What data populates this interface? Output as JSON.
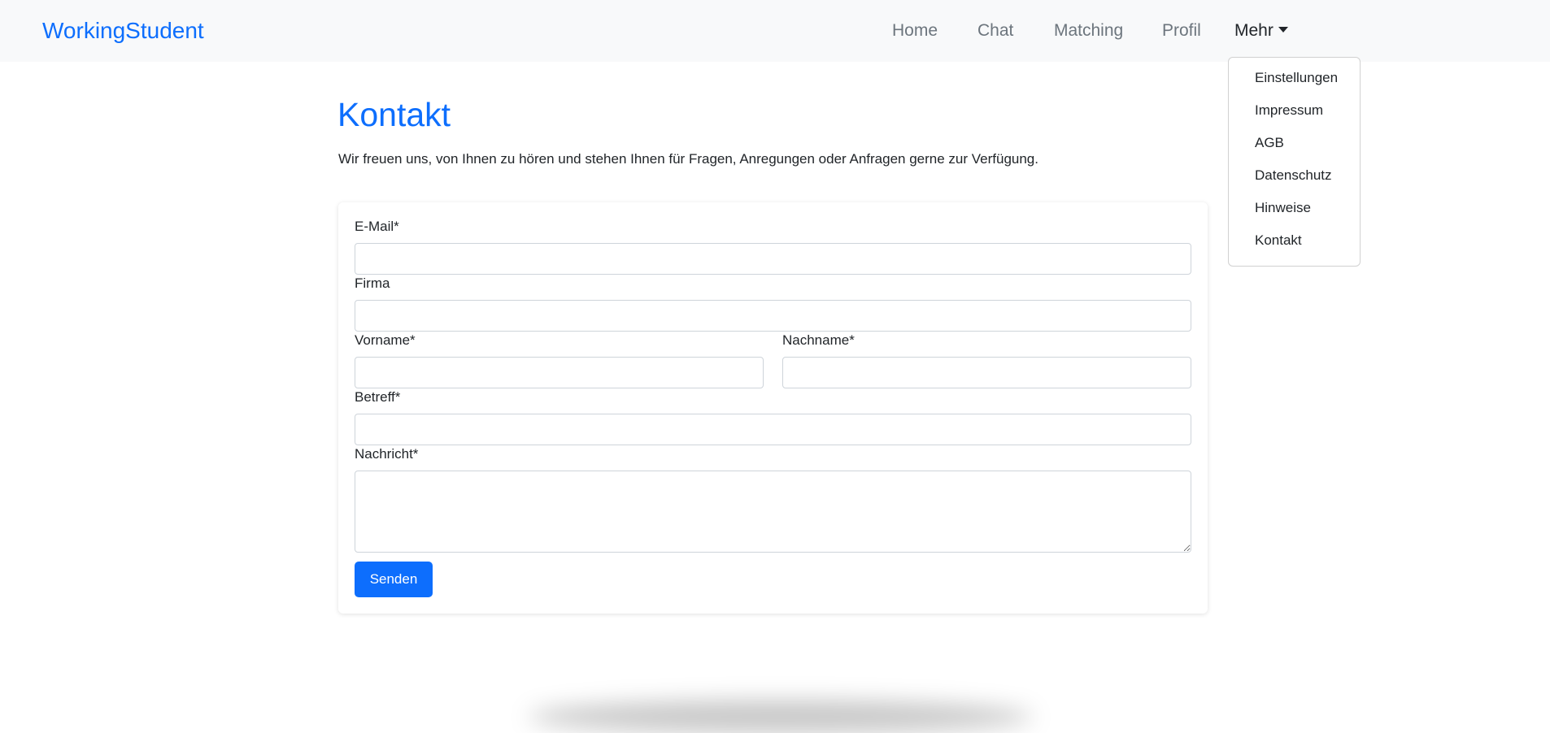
{
  "nav": {
    "brand": "WorkingStudent",
    "links": {
      "home": "Home",
      "chat": "Chat",
      "matching": "Matching",
      "profil": "Profil",
      "mehr": "Mehr"
    },
    "dropdown": [
      "Einstellungen",
      "Impressum",
      "AGB",
      "Datenschutz",
      "Hinweise",
      "Kontakt"
    ]
  },
  "main": {
    "title": "Kontakt",
    "intro": "Wir freuen uns, von Ihnen zu hören und stehen Ihnen für Fragen, Anregungen oder Anfragen gerne zur Verfügung."
  },
  "form": {
    "email_label": "E-Mail*",
    "email_value": "",
    "firma_label": "Firma",
    "firma_value": "",
    "vorname_label": "Vorname*",
    "vorname_value": "",
    "nachname_label": "Nachname*",
    "nachname_value": "",
    "betreff_label": "Betreff*",
    "betreff_value": "",
    "nachricht_label": "Nachricht*",
    "nachricht_value": "",
    "submit_label": "Senden"
  },
  "colors": {
    "primary": "#0d6efd",
    "navbar_bg": "#f8f9fa",
    "nav_link": "#6c757d",
    "text": "#212529"
  }
}
